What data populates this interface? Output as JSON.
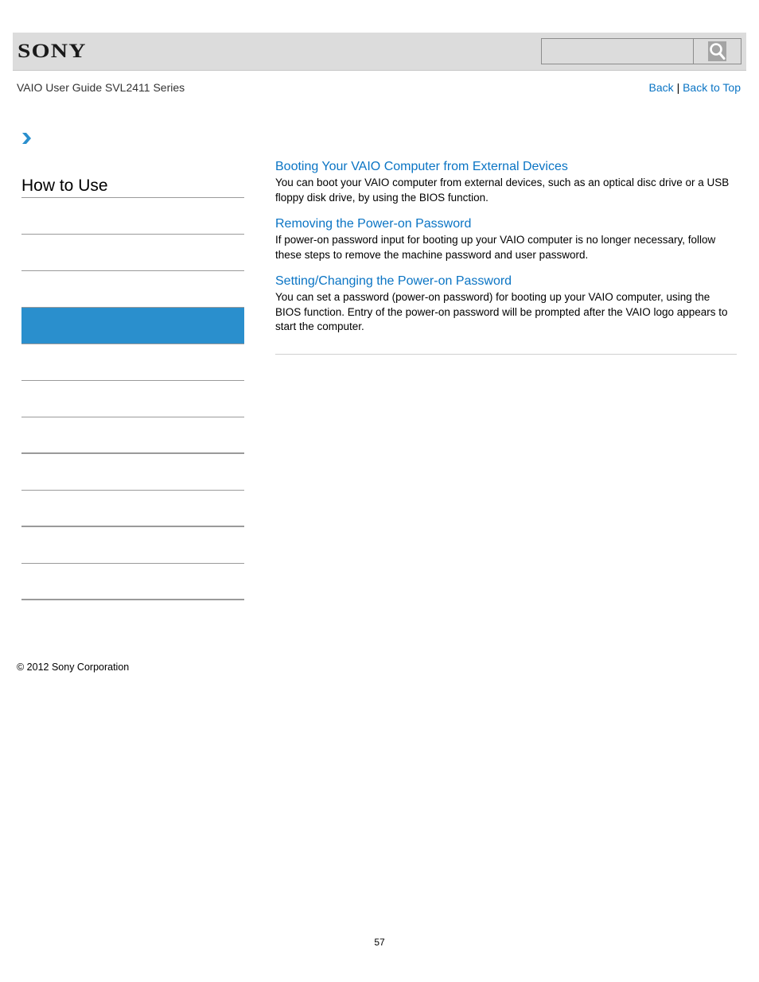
{
  "header": {
    "logo_text": "SONY",
    "search": {
      "value": "",
      "placeholder": "",
      "button_icon": "magnifier-icon"
    }
  },
  "subheader": {
    "guide_title": "VAIO User Guide SVL2411 Series",
    "links": {
      "back": "Back",
      "separator": "|",
      "back_to_top": "Back to Top"
    }
  },
  "breadcrumb": {
    "icon": "chevron-right-icon"
  },
  "sidebar": {
    "title": "How to Use",
    "items": [
      {
        "label": "",
        "active": false
      },
      {
        "label": "",
        "active": false
      },
      {
        "label": "",
        "active": false
      },
      {
        "label": "",
        "active": true
      },
      {
        "label": "",
        "active": false
      },
      {
        "label": "",
        "active": false
      },
      {
        "label": "",
        "active": false
      },
      {
        "label": "",
        "active": false
      },
      {
        "label": "",
        "active": false
      },
      {
        "label": "",
        "active": false
      },
      {
        "label": "",
        "active": false
      }
    ],
    "active_color": "#2a8fcd"
  },
  "main": {
    "entries": [
      {
        "title": "Booting Your VAIO Computer from External Devices",
        "description": "You can boot your VAIO computer from external devices, such as an optical disc drive or a USB floppy disk drive, by using the BIOS function."
      },
      {
        "title": "Removing the Power-on Password",
        "description": "If power-on password input for booting up your VAIO computer is no longer necessary, follow these steps to remove the machine password and user password."
      },
      {
        "title": "Setting/Changing the Power-on Password",
        "description": "You can set a password (power-on password) for booting up your VAIO computer, using the BIOS function. Entry of the power-on password will be prompted after the VAIO logo appears to start the computer."
      }
    ],
    "link_color": "#0a74c4"
  },
  "footer": {
    "copyright": "© 2012 Sony Corporation",
    "page_number": "57"
  }
}
